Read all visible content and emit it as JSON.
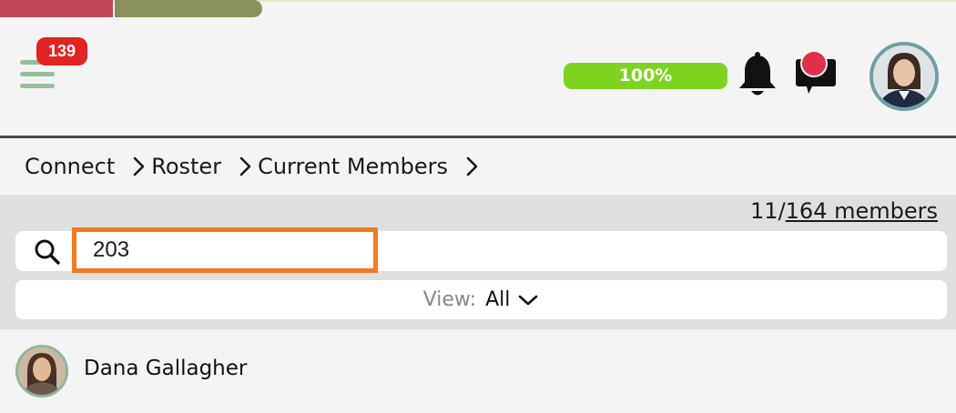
{
  "header": {
    "menu_badge": "139",
    "progress_label": "100%",
    "progress_value": 100,
    "icons": {
      "menu": "hamburger-icon",
      "notifications": "bell-icon",
      "messages": "chat-icon",
      "profile": "avatar"
    },
    "colors": {
      "badge": "#e02424",
      "progress": "#7ed321",
      "menu_lines": "#96bd9c",
      "chat_dot": "#e0304a"
    }
  },
  "breadcrumb": {
    "items": [
      "Connect",
      "Roster",
      "Current Members"
    ]
  },
  "members": {
    "shown": "11/",
    "total_link": "164 members"
  },
  "search": {
    "value": "203",
    "placeholder": ""
  },
  "view": {
    "label": "View:",
    "value": "All"
  },
  "list": {
    "items": [
      {
        "name": "Dana Gallagher"
      }
    ]
  },
  "top_strip": {
    "colors": [
      "#c0485a",
      "#8a9158"
    ]
  }
}
